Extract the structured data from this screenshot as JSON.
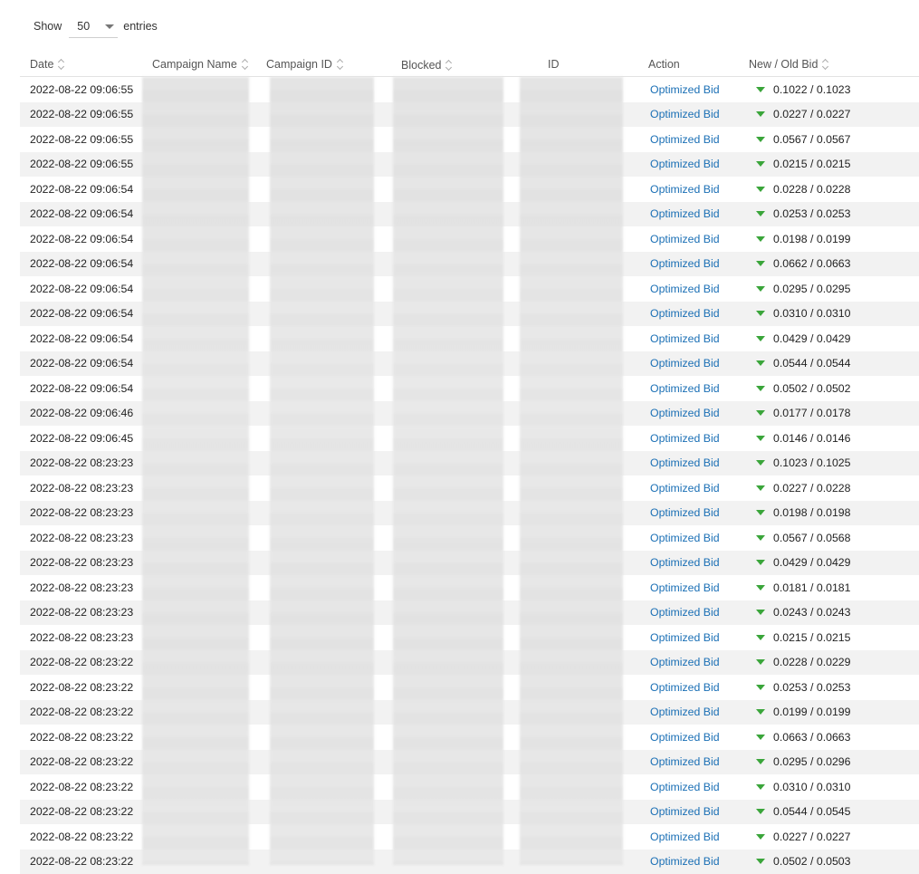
{
  "length_control": {
    "prefix": "Show",
    "value": "50",
    "suffix": "entries"
  },
  "columns": [
    {
      "label": "Date",
      "sortable": true
    },
    {
      "label": "Campaign Name",
      "sortable": true
    },
    {
      "label": "Campaign ID",
      "sortable": true
    },
    {
      "label": "Blocked",
      "sortable": true
    },
    {
      "label": "ID",
      "sortable": false
    },
    {
      "label": "Action",
      "sortable": false
    },
    {
      "label": "New / Old Bid",
      "sortable": true
    }
  ],
  "rows": [
    {
      "date": "2022-08-22 09:06:55",
      "action": "Optimized Bid",
      "bid": "0.1022 / 0.1023"
    },
    {
      "date": "2022-08-22 09:06:55",
      "action": "Optimized Bid",
      "bid": "0.0227 / 0.0227"
    },
    {
      "date": "2022-08-22 09:06:55",
      "action": "Optimized Bid",
      "bid": "0.0567 / 0.0567"
    },
    {
      "date": "2022-08-22 09:06:55",
      "action": "Optimized Bid",
      "bid": "0.0215 / 0.0215"
    },
    {
      "date": "2022-08-22 09:06:54",
      "action": "Optimized Bid",
      "bid": "0.0228 / 0.0228"
    },
    {
      "date": "2022-08-22 09:06:54",
      "action": "Optimized Bid",
      "bid": "0.0253 / 0.0253"
    },
    {
      "date": "2022-08-22 09:06:54",
      "action": "Optimized Bid",
      "bid": "0.0198 / 0.0199"
    },
    {
      "date": "2022-08-22 09:06:54",
      "action": "Optimized Bid",
      "bid": "0.0662 / 0.0663"
    },
    {
      "date": "2022-08-22 09:06:54",
      "action": "Optimized Bid",
      "bid": "0.0295 / 0.0295"
    },
    {
      "date": "2022-08-22 09:06:54",
      "action": "Optimized Bid",
      "bid": "0.0310 / 0.0310"
    },
    {
      "date": "2022-08-22 09:06:54",
      "action": "Optimized Bid",
      "bid": "0.0429 / 0.0429"
    },
    {
      "date": "2022-08-22 09:06:54",
      "action": "Optimized Bid",
      "bid": "0.0544 / 0.0544"
    },
    {
      "date": "2022-08-22 09:06:54",
      "action": "Optimized Bid",
      "bid": "0.0502 / 0.0502"
    },
    {
      "date": "2022-08-22 09:06:46",
      "action": "Optimized Bid",
      "bid": "0.0177 / 0.0178"
    },
    {
      "date": "2022-08-22 09:06:45",
      "action": "Optimized Bid",
      "bid": "0.0146 / 0.0146"
    },
    {
      "date": "2022-08-22 08:23:23",
      "action": "Optimized Bid",
      "bid": "0.1023 / 0.1025"
    },
    {
      "date": "2022-08-22 08:23:23",
      "action": "Optimized Bid",
      "bid": "0.0227 / 0.0228"
    },
    {
      "date": "2022-08-22 08:23:23",
      "action": "Optimized Bid",
      "bid": "0.0198 / 0.0198"
    },
    {
      "date": "2022-08-22 08:23:23",
      "action": "Optimized Bid",
      "bid": "0.0567 / 0.0568"
    },
    {
      "date": "2022-08-22 08:23:23",
      "action": "Optimized Bid",
      "bid": "0.0429 / 0.0429"
    },
    {
      "date": "2022-08-22 08:23:23",
      "action": "Optimized Bid",
      "bid": "0.0181 / 0.0181"
    },
    {
      "date": "2022-08-22 08:23:23",
      "action": "Optimized Bid",
      "bid": "0.0243 / 0.0243"
    },
    {
      "date": "2022-08-22 08:23:23",
      "action": "Optimized Bid",
      "bid": "0.0215 / 0.0215"
    },
    {
      "date": "2022-08-22 08:23:22",
      "action": "Optimized Bid",
      "bid": "0.0228 / 0.0229"
    },
    {
      "date": "2022-08-22 08:23:22",
      "action": "Optimized Bid",
      "bid": "0.0253 / 0.0253"
    },
    {
      "date": "2022-08-22 08:23:22",
      "action": "Optimized Bid",
      "bid": "0.0199 / 0.0199"
    },
    {
      "date": "2022-08-22 08:23:22",
      "action": "Optimized Bid",
      "bid": "0.0663 / 0.0663"
    },
    {
      "date": "2022-08-22 08:23:22",
      "action": "Optimized Bid",
      "bid": "0.0295 / 0.0296"
    },
    {
      "date": "2022-08-22 08:23:22",
      "action": "Optimized Bid",
      "bid": "0.0310 / 0.0310"
    },
    {
      "date": "2022-08-22 08:23:22",
      "action": "Optimized Bid",
      "bid": "0.0544 / 0.0545"
    },
    {
      "date": "2022-08-22 08:23:22",
      "action": "Optimized Bid",
      "bid": "0.0227 / 0.0227"
    },
    {
      "date": "2022-08-22 08:23:22",
      "action": "Optimized Bid",
      "bid": "0.0502 / 0.0503"
    }
  ],
  "colors": {
    "action_link": "#1a6fb5",
    "decrease_arrow": "#3aa53a",
    "stripe": "#f2f2f2"
  },
  "icons": {
    "bid_change": "triangle-down-icon",
    "sort": "sort-icon",
    "dropdown": "chevron-down-icon"
  }
}
